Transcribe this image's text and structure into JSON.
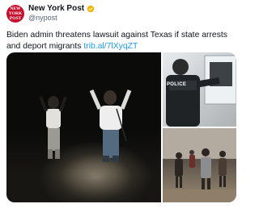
{
  "account": {
    "name": "New York Post",
    "handle": "@nypost",
    "avatar_text": "NEW YORK POST",
    "verified_color": "#f4b400"
  },
  "tweet": {
    "text": "Biden admin threatens lawsuit against Texas if state arrests and deport migrants ",
    "link": "trib.al/7lXyqZT"
  },
  "media": {
    "badge_text": "POLICE",
    "images": [
      "migrants-hands-raised-night",
      "police-officer-van",
      "migrants-walking-group"
    ]
  },
  "colors": {
    "link": "#1d9bf0",
    "text": "#0f1419",
    "secondary": "#536471",
    "brand": "#c8102e"
  }
}
